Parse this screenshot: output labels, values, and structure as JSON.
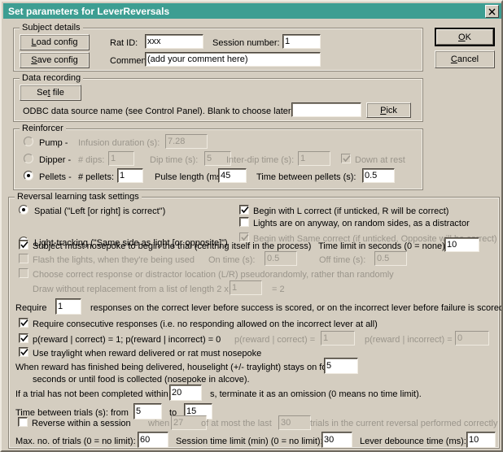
{
  "window": {
    "title": "Set parameters for LeverReversals",
    "close_label": "✕"
  },
  "buttons": {
    "ok": "OK",
    "cancel": "Cancel",
    "load_config": "Load config",
    "save_config": "Save config",
    "set_file": "Set file",
    "pick": "Pick"
  },
  "subject_details": {
    "legend": "Subject details",
    "rat_id_label": "Rat ID:",
    "rat_id_value": "xxx",
    "session_number_label": "Session number:",
    "session_number_value": "1",
    "comment_label": "Comment:",
    "comment_value": "(add your comment here)"
  },
  "data_recording": {
    "legend": "Data recording",
    "odbc_label": "ODBC data source name (see Control Panel). Blank to choose later:",
    "odbc_value": ""
  },
  "reinforcer": {
    "legend": "Reinforcer",
    "pump_label": "Pump -",
    "pump_selected": false,
    "infusion_duration_label": "Infusion duration (s):",
    "infusion_duration_value": "7.28",
    "dipper_label": "Dipper -",
    "dipper_selected": false,
    "dips_label": "# dips:",
    "dips_value": "1",
    "dip_time_label": "Dip time (s):",
    "dip_time_value": "5",
    "interdip_label": "Inter-dip time (s):",
    "interdip_value": "1",
    "down_at_rest_label": "Down at rest",
    "down_at_rest_checked": true,
    "pellets_label": "Pellets -",
    "pellets_selected": true,
    "num_pellets_label": "# pellets:",
    "num_pellets_value": "1",
    "pulse_length_label": "Pulse length (ms):",
    "pulse_length_value": "45",
    "time_between_pellets_label": "Time between pellets (s):",
    "time_between_pellets_value": "0.5"
  },
  "task": {
    "legend": "Reversal learning task settings",
    "spatial_label": "Spatial (\"Left [or right] is correct\")",
    "spatial_selected": true,
    "light_tracking_label": "Light-tracking (\"Same side as light [or opposite]\")",
    "light_tracking_selected": false,
    "begin_l_correct_label": "Begin with L correct (if unticked, R will be correct)",
    "begin_l_correct_checked": true,
    "lights_distractor_label": "Lights are on anyway, on random sides, as a distractor",
    "lights_distractor_checked": false,
    "begin_same_correct_label": "Begin with Same correct (if unticked, Opposite will be correct)",
    "begin_same_correct_checked": true,
    "nosepoke_begin_label": "Subject must nosepoke to begin the trial (centring itself in the process)",
    "nosepoke_begin_checked": true,
    "time_limit_label": "Time limit in seconds (0 = none):",
    "time_limit_value": "10",
    "flash_lights_label": "Flash the lights, when they're being used",
    "flash_lights_checked": false,
    "on_time_label": "On time (s):",
    "on_time_value": "0.5",
    "off_time_label": "Off time (s):",
    "off_time_value": "0.5",
    "pseudorandom_label": "Choose correct response or distractor location (L/R) pseudorandomly, rather than randomly",
    "pseudorandom_checked": false,
    "draw_without_replacement_label": "Draw without replacement from a list of length 2 x",
    "draw_without_replacement_value": "1",
    "draw_equals_label": "= 2",
    "require_prefix_label": "Require",
    "require_value": "1",
    "require_suffix_label": "responses on the correct lever before success is scored, or on the incorrect lever before failure is scored",
    "consecutive_label": "Require consecutive responses (i.e. no responding allowed on the incorrect lever at all)",
    "consecutive_checked": true,
    "preward_shortcut_label": "p(reward | correct) = 1; p(reward | incorrect) = 0",
    "preward_shortcut_checked": true,
    "preward_correct_label": "p(reward | correct) =",
    "preward_correct_value": "1",
    "preward_incorrect_label": "p(reward | incorrect) =",
    "preward_incorrect_value": "0",
    "traylight_label": "Use traylight when reward delivered or rat must nosepoke",
    "traylight_checked": true,
    "houselight_line1_label": "When reward has finished being delivered, houselight (+/- traylight) stays on for",
    "houselight_value": "5",
    "houselight_line2_label": "seconds or until food is collected (nosepoke in alcove).",
    "omission_prefix_label": "If a trial has not been completed within",
    "omission_value": "20",
    "omission_suffix_label": "s, terminate it as an omission (0 means no time limit).",
    "iti_label": "Time between trials (s): from",
    "iti_from_value": "5",
    "iti_to_label": "to",
    "iti_to_value": "15",
    "reverse_within_label": "Reverse within a session",
    "reverse_within_checked": false,
    "reverse_when_label": "when",
    "reverse_when_value": "27",
    "reverse_of_label": "of at most the last",
    "reverse_of_value": "30",
    "reverse_suffix_label": "trials in the current reversal performed correctly",
    "max_trials_label": "Max. no. of trials (0 = no limit):",
    "max_trials_value": "60",
    "session_time_limit_label": "Session time limit (min) (0 = no limit):",
    "session_time_limit_value": "30",
    "lever_debounce_label": "Lever debounce time (ms):",
    "lever_debounce_value": "10"
  },
  "colors": {
    "titlebar": "#3d9e92",
    "dialog_face": "#d4cdc0",
    "disabled_text": "#9a958b",
    "field_bg": "#ffffff"
  }
}
